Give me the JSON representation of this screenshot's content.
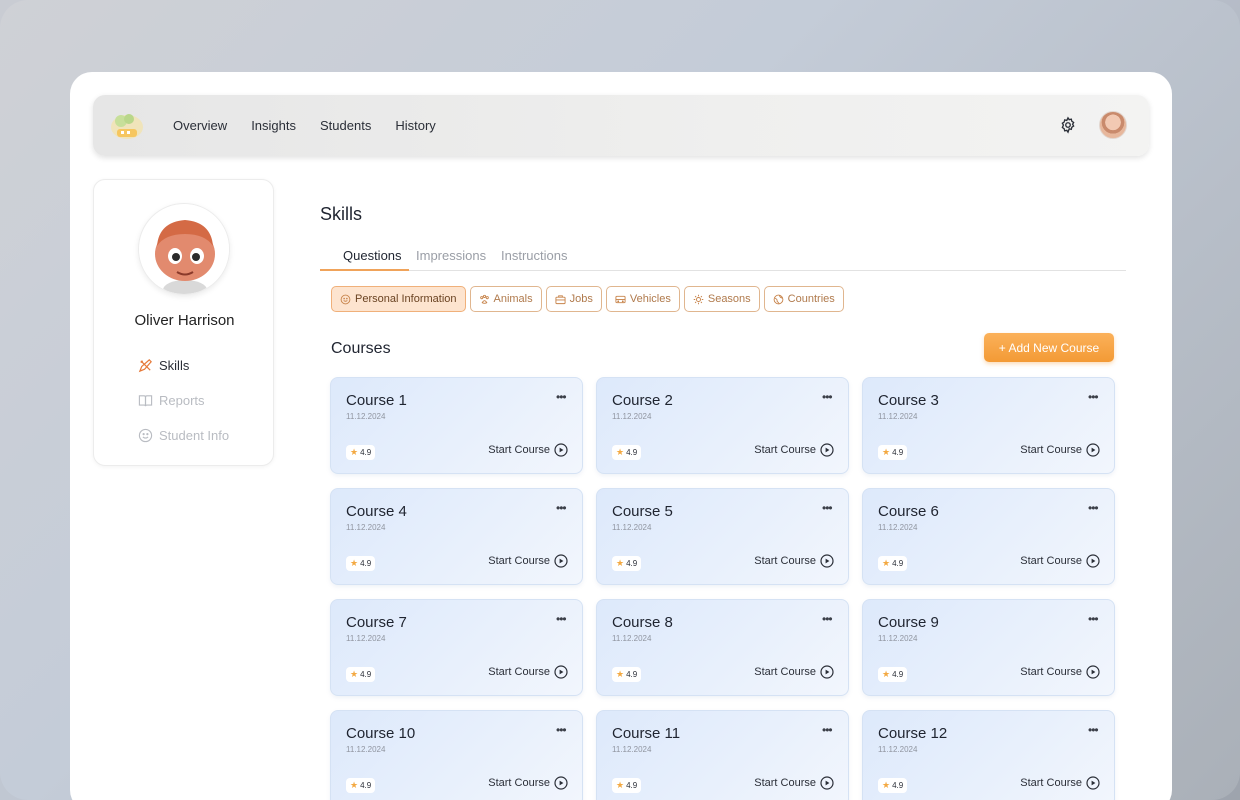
{
  "nav": {
    "items": [
      "Overview",
      "Insights",
      "Students",
      "History"
    ]
  },
  "profile": {
    "name": "Oliver Harrison"
  },
  "sidebar": {
    "items": [
      {
        "label": "Skills",
        "icon": "pencil-ruler-icon",
        "active": true
      },
      {
        "label": "Reports",
        "icon": "book-icon",
        "active": false
      },
      {
        "label": "Student Info",
        "icon": "smile-icon",
        "active": false
      }
    ]
  },
  "main": {
    "title": "Skills",
    "tabs": [
      {
        "label": "Questions",
        "active": true
      },
      {
        "label": "Impressions",
        "active": false
      },
      {
        "label": "Instructions",
        "active": false
      }
    ],
    "chips": [
      {
        "label": "Personal Information",
        "icon": "smile-icon",
        "active": true
      },
      {
        "label": "Animals",
        "icon": "paw-icon",
        "active": false
      },
      {
        "label": "Jobs",
        "icon": "briefcase-icon",
        "active": false
      },
      {
        "label": "Vehicles",
        "icon": "bus-icon",
        "active": false
      },
      {
        "label": "Seasons",
        "icon": "sun-icon",
        "active": false
      },
      {
        "label": "Countries",
        "icon": "globe-icon",
        "active": false
      }
    ],
    "courses_title": "Courses",
    "add_button": "+ Add New Course",
    "courses": [
      {
        "title": "Course 1",
        "date": "11.12.2024",
        "rating": "4.9",
        "action": "Start Course"
      },
      {
        "title": "Course 2",
        "date": "11.12.2024",
        "rating": "4.9",
        "action": "Start Course"
      },
      {
        "title": "Course 3",
        "date": "11.12.2024",
        "rating": "4.9",
        "action": "Start Course"
      },
      {
        "title": "Course 4",
        "date": "11.12.2024",
        "rating": "4.9",
        "action": "Start Course"
      },
      {
        "title": "Course 5",
        "date": "11.12.2024",
        "rating": "4.9",
        "action": "Start Course"
      },
      {
        "title": "Course 6",
        "date": "11.12.2024",
        "rating": "4.9",
        "action": "Start Course"
      },
      {
        "title": "Course 7",
        "date": "11.12.2024",
        "rating": "4.9",
        "action": "Start Course"
      },
      {
        "title": "Course 8",
        "date": "11.12.2024",
        "rating": "4.9",
        "action": "Start Course"
      },
      {
        "title": "Course 9",
        "date": "11.12.2024",
        "rating": "4.9",
        "action": "Start Course"
      },
      {
        "title": "Course 10",
        "date": "11.12.2024",
        "rating": "4.9",
        "action": "Start Course"
      },
      {
        "title": "Course 11",
        "date": "11.12.2024",
        "rating": "4.9",
        "action": "Start Course"
      },
      {
        "title": "Course 12",
        "date": "11.12.2024",
        "rating": "4.9",
        "action": "Start Course"
      }
    ]
  },
  "colors": {
    "accent": "#f39a35",
    "chip_active_bg": "#fde4cf",
    "card_bg": "#e3edfb"
  }
}
